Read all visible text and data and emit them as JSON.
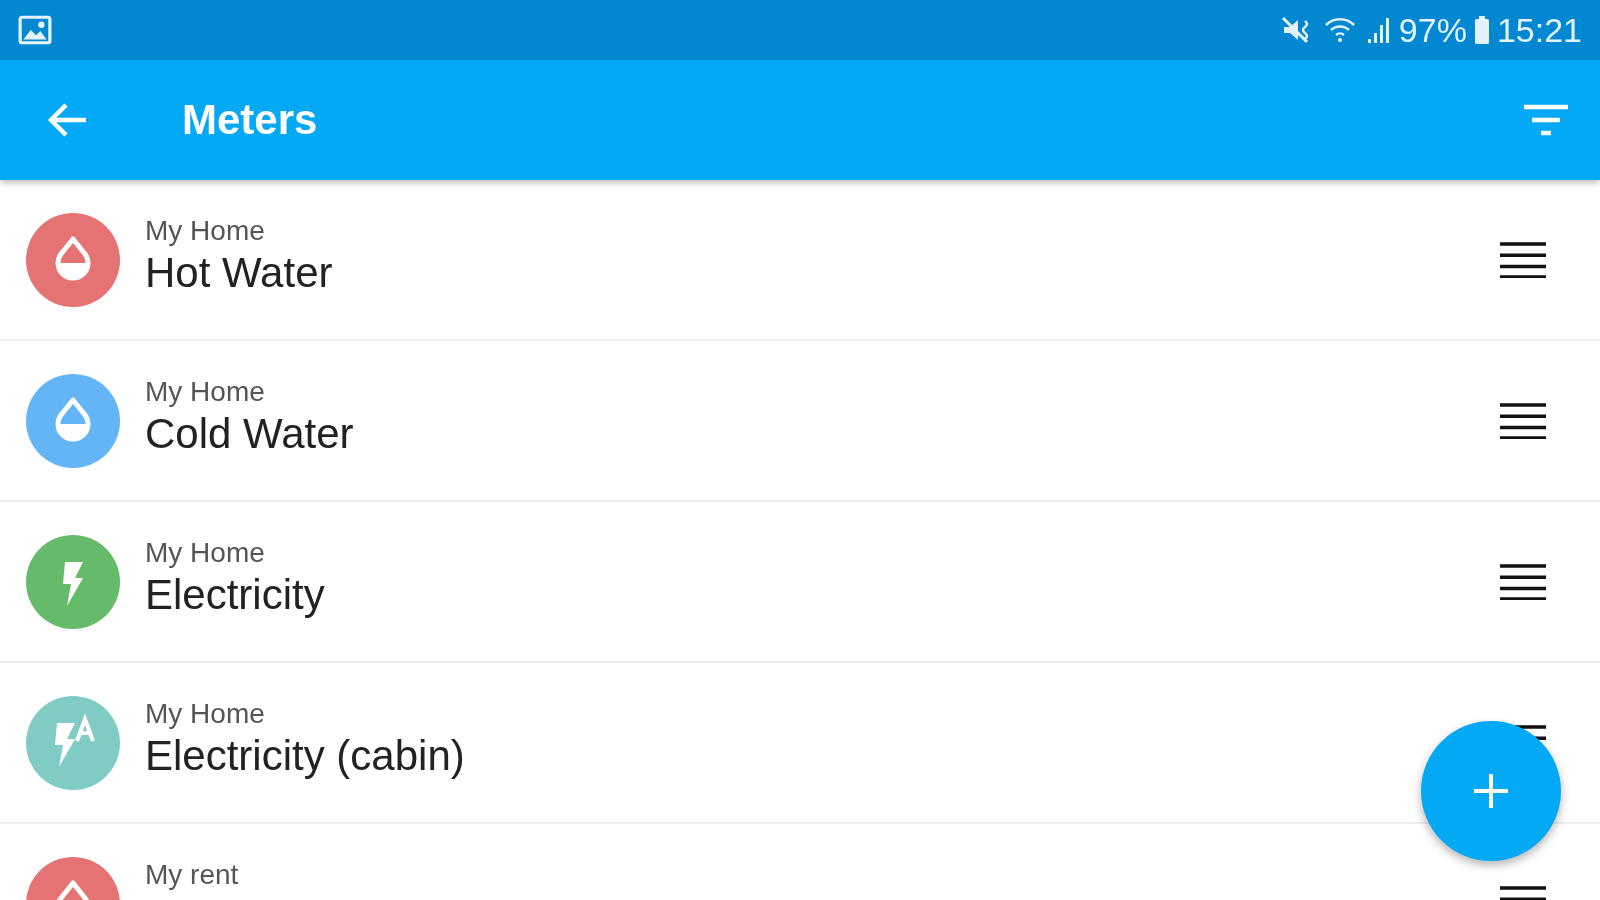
{
  "status_bar": {
    "battery": "97%",
    "time": "15:21"
  },
  "app_bar": {
    "title": "Meters"
  },
  "meters": [
    {
      "kind": "drop",
      "color": "#e57373",
      "subtitle": "My Home",
      "title": "Hot Water"
    },
    {
      "kind": "drop",
      "color": "#64b5f6",
      "subtitle": "My Home",
      "title": "Cold Water"
    },
    {
      "kind": "bolt",
      "color": "#66bb6a",
      "subtitle": "My Home",
      "title": "Electricity"
    },
    {
      "kind": "bolt-a",
      "color": "#80cbc4",
      "subtitle": "My Home",
      "title": "Electricity (cabin)"
    },
    {
      "kind": "drop",
      "color": "#e57373",
      "subtitle": "My rent"
    }
  ]
}
